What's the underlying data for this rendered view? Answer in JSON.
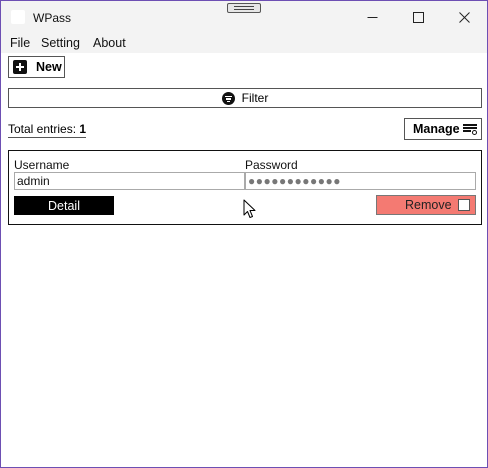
{
  "window": {
    "title": "WPass",
    "controls": {
      "minimize_icon": "minimize-icon",
      "maximize_icon": "maximize-icon",
      "close_icon": "close-icon"
    }
  },
  "menu": {
    "items": [
      {
        "label": "File"
      },
      {
        "label": "Setting"
      },
      {
        "label": "About"
      }
    ]
  },
  "toolbar": {
    "new_label": "New",
    "new_icon": "plus-square-icon"
  },
  "filter": {
    "label": "Filter",
    "icon": "filter-icon"
  },
  "summary": {
    "total_label": "Total entries:",
    "total_count": "1"
  },
  "manage": {
    "label": "Manage",
    "icon": "manage-list-icon"
  },
  "entries": [
    {
      "username_label": "Username",
      "username_value": "admin",
      "password_label": "Password",
      "password_value": "●●●●●●●●●●●●",
      "detail_label": "Detail",
      "remove_label": "Remove",
      "remove_checked": false
    }
  ],
  "colors": {
    "remove_bg": "#f47a72",
    "detail_bg": "#000000",
    "window_border": "#6d4fb3"
  }
}
